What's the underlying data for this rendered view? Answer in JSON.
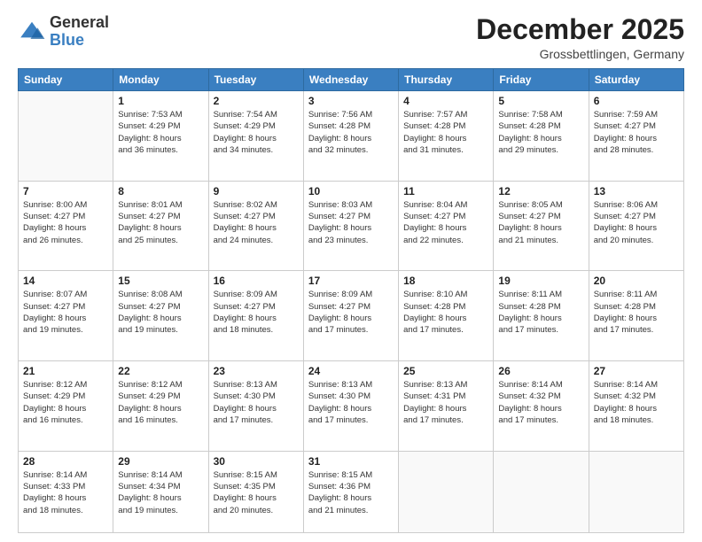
{
  "logo": {
    "general": "General",
    "blue": "Blue"
  },
  "header": {
    "month": "December 2025",
    "location": "Grossbettlingen, Germany"
  },
  "weekdays": [
    "Sunday",
    "Monday",
    "Tuesday",
    "Wednesday",
    "Thursday",
    "Friday",
    "Saturday"
  ],
  "weeks": [
    [
      {
        "day": "",
        "info": ""
      },
      {
        "day": "1",
        "info": "Sunrise: 7:53 AM\nSunset: 4:29 PM\nDaylight: 8 hours\nand 36 minutes."
      },
      {
        "day": "2",
        "info": "Sunrise: 7:54 AM\nSunset: 4:29 PM\nDaylight: 8 hours\nand 34 minutes."
      },
      {
        "day": "3",
        "info": "Sunrise: 7:56 AM\nSunset: 4:28 PM\nDaylight: 8 hours\nand 32 minutes."
      },
      {
        "day": "4",
        "info": "Sunrise: 7:57 AM\nSunset: 4:28 PM\nDaylight: 8 hours\nand 31 minutes."
      },
      {
        "day": "5",
        "info": "Sunrise: 7:58 AM\nSunset: 4:28 PM\nDaylight: 8 hours\nand 29 minutes."
      },
      {
        "day": "6",
        "info": "Sunrise: 7:59 AM\nSunset: 4:27 PM\nDaylight: 8 hours\nand 28 minutes."
      }
    ],
    [
      {
        "day": "7",
        "info": "Sunrise: 8:00 AM\nSunset: 4:27 PM\nDaylight: 8 hours\nand 26 minutes."
      },
      {
        "day": "8",
        "info": "Sunrise: 8:01 AM\nSunset: 4:27 PM\nDaylight: 8 hours\nand 25 minutes."
      },
      {
        "day": "9",
        "info": "Sunrise: 8:02 AM\nSunset: 4:27 PM\nDaylight: 8 hours\nand 24 minutes."
      },
      {
        "day": "10",
        "info": "Sunrise: 8:03 AM\nSunset: 4:27 PM\nDaylight: 8 hours\nand 23 minutes."
      },
      {
        "day": "11",
        "info": "Sunrise: 8:04 AM\nSunset: 4:27 PM\nDaylight: 8 hours\nand 22 minutes."
      },
      {
        "day": "12",
        "info": "Sunrise: 8:05 AM\nSunset: 4:27 PM\nDaylight: 8 hours\nand 21 minutes."
      },
      {
        "day": "13",
        "info": "Sunrise: 8:06 AM\nSunset: 4:27 PM\nDaylight: 8 hours\nand 20 minutes."
      }
    ],
    [
      {
        "day": "14",
        "info": "Sunrise: 8:07 AM\nSunset: 4:27 PM\nDaylight: 8 hours\nand 19 minutes."
      },
      {
        "day": "15",
        "info": "Sunrise: 8:08 AM\nSunset: 4:27 PM\nDaylight: 8 hours\nand 19 minutes."
      },
      {
        "day": "16",
        "info": "Sunrise: 8:09 AM\nSunset: 4:27 PM\nDaylight: 8 hours\nand 18 minutes."
      },
      {
        "day": "17",
        "info": "Sunrise: 8:09 AM\nSunset: 4:27 PM\nDaylight: 8 hours\nand 17 minutes."
      },
      {
        "day": "18",
        "info": "Sunrise: 8:10 AM\nSunset: 4:28 PM\nDaylight: 8 hours\nand 17 minutes."
      },
      {
        "day": "19",
        "info": "Sunrise: 8:11 AM\nSunset: 4:28 PM\nDaylight: 8 hours\nand 17 minutes."
      },
      {
        "day": "20",
        "info": "Sunrise: 8:11 AM\nSunset: 4:28 PM\nDaylight: 8 hours\nand 17 minutes."
      }
    ],
    [
      {
        "day": "21",
        "info": "Sunrise: 8:12 AM\nSunset: 4:29 PM\nDaylight: 8 hours\nand 16 minutes."
      },
      {
        "day": "22",
        "info": "Sunrise: 8:12 AM\nSunset: 4:29 PM\nDaylight: 8 hours\nand 16 minutes."
      },
      {
        "day": "23",
        "info": "Sunrise: 8:13 AM\nSunset: 4:30 PM\nDaylight: 8 hours\nand 17 minutes."
      },
      {
        "day": "24",
        "info": "Sunrise: 8:13 AM\nSunset: 4:30 PM\nDaylight: 8 hours\nand 17 minutes."
      },
      {
        "day": "25",
        "info": "Sunrise: 8:13 AM\nSunset: 4:31 PM\nDaylight: 8 hours\nand 17 minutes."
      },
      {
        "day": "26",
        "info": "Sunrise: 8:14 AM\nSunset: 4:32 PM\nDaylight: 8 hours\nand 17 minutes."
      },
      {
        "day": "27",
        "info": "Sunrise: 8:14 AM\nSunset: 4:32 PM\nDaylight: 8 hours\nand 18 minutes."
      }
    ],
    [
      {
        "day": "28",
        "info": "Sunrise: 8:14 AM\nSunset: 4:33 PM\nDaylight: 8 hours\nand 18 minutes."
      },
      {
        "day": "29",
        "info": "Sunrise: 8:14 AM\nSunset: 4:34 PM\nDaylight: 8 hours\nand 19 minutes."
      },
      {
        "day": "30",
        "info": "Sunrise: 8:15 AM\nSunset: 4:35 PM\nDaylight: 8 hours\nand 20 minutes."
      },
      {
        "day": "31",
        "info": "Sunrise: 8:15 AM\nSunset: 4:36 PM\nDaylight: 8 hours\nand 21 minutes."
      },
      {
        "day": "",
        "info": ""
      },
      {
        "day": "",
        "info": ""
      },
      {
        "day": "",
        "info": ""
      }
    ]
  ]
}
